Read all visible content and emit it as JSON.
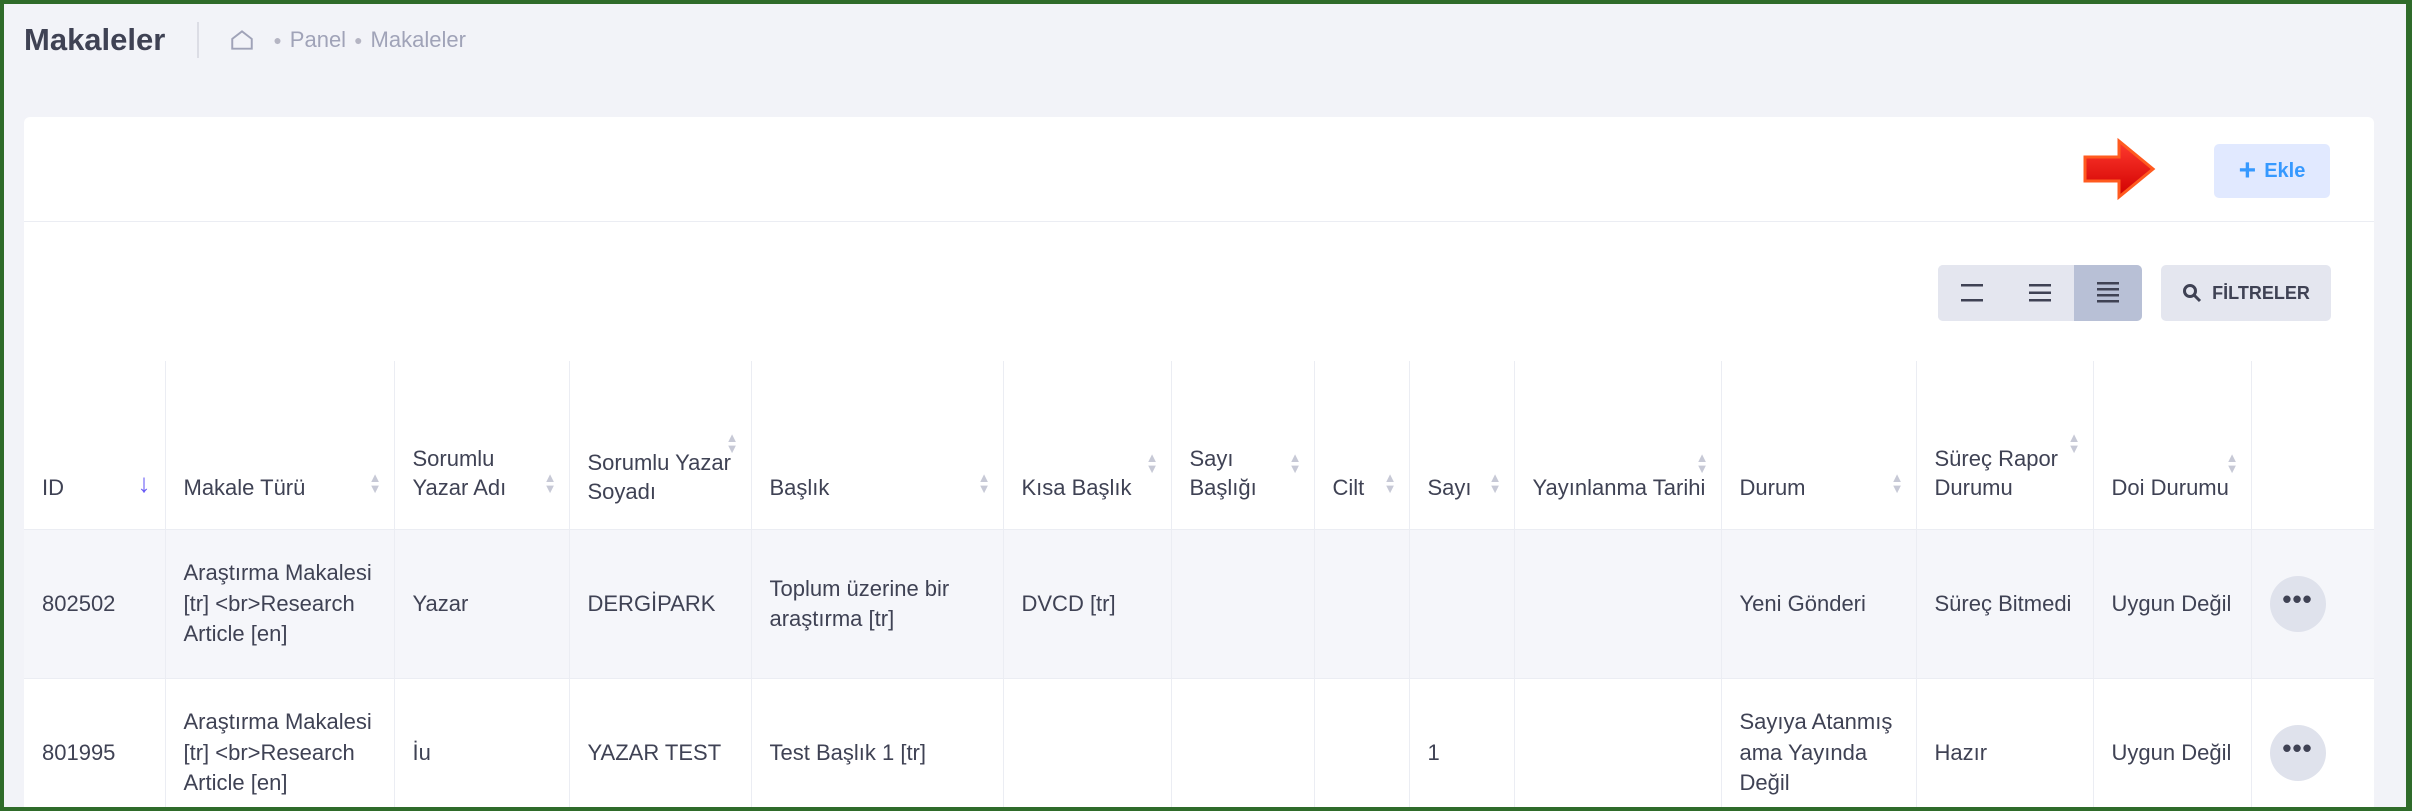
{
  "header": {
    "title": "Makaleler",
    "breadcrumb": [
      "Panel",
      "Makaleler"
    ]
  },
  "actions": {
    "add_label": "Ekle",
    "filter_label": "FİLTRELER"
  },
  "table": {
    "columns": [
      "ID",
      "Makale Türü",
      "Sorumlu Yazar Adı",
      "Sorumlu Yazar Soyadı",
      "Başlık",
      "Kısa Başlık",
      "Sayı Başlığı",
      "Cilt",
      "Sayı",
      "Yayınlanma Tarihi",
      "Durum",
      "Süreç Rapor Durumu",
      "Doi Durumu"
    ],
    "rows": [
      {
        "id": "802502",
        "type": "Araştırma Makalesi [tr] <br>Research Article [en]",
        "author_name": "Yazar",
        "author_surname": "DERGİPARK",
        "title": "Toplum üzerine bir araştırma [tr]",
        "short_title": "DVCD [tr]",
        "issue_title": "",
        "volume": "",
        "issue": "",
        "pub_date": "",
        "status": "Yeni Gönderi",
        "report_status": "Süreç Bitmedi",
        "doi_status": "Uygun Değil"
      },
      {
        "id": "801995",
        "type": "Araştırma Makalesi [tr] <br>Research Article [en]",
        "author_name": "İu",
        "author_surname": "YAZAR TEST",
        "title": "Test Başlık 1 [tr]",
        "short_title": "",
        "issue_title": "",
        "volume": "",
        "issue": "1",
        "pub_date": "",
        "status": "Sayıya Atanmış ama Yayında Değil",
        "report_status": "Hazır",
        "doi_status": "Uygun Değil"
      }
    ],
    "row_menu_glyph": "•••"
  },
  "colors": {
    "accent": "#3699ff",
    "sort_active": "#6a5cf5",
    "arrow": "#ff0000",
    "border": "#2f6b2a"
  }
}
